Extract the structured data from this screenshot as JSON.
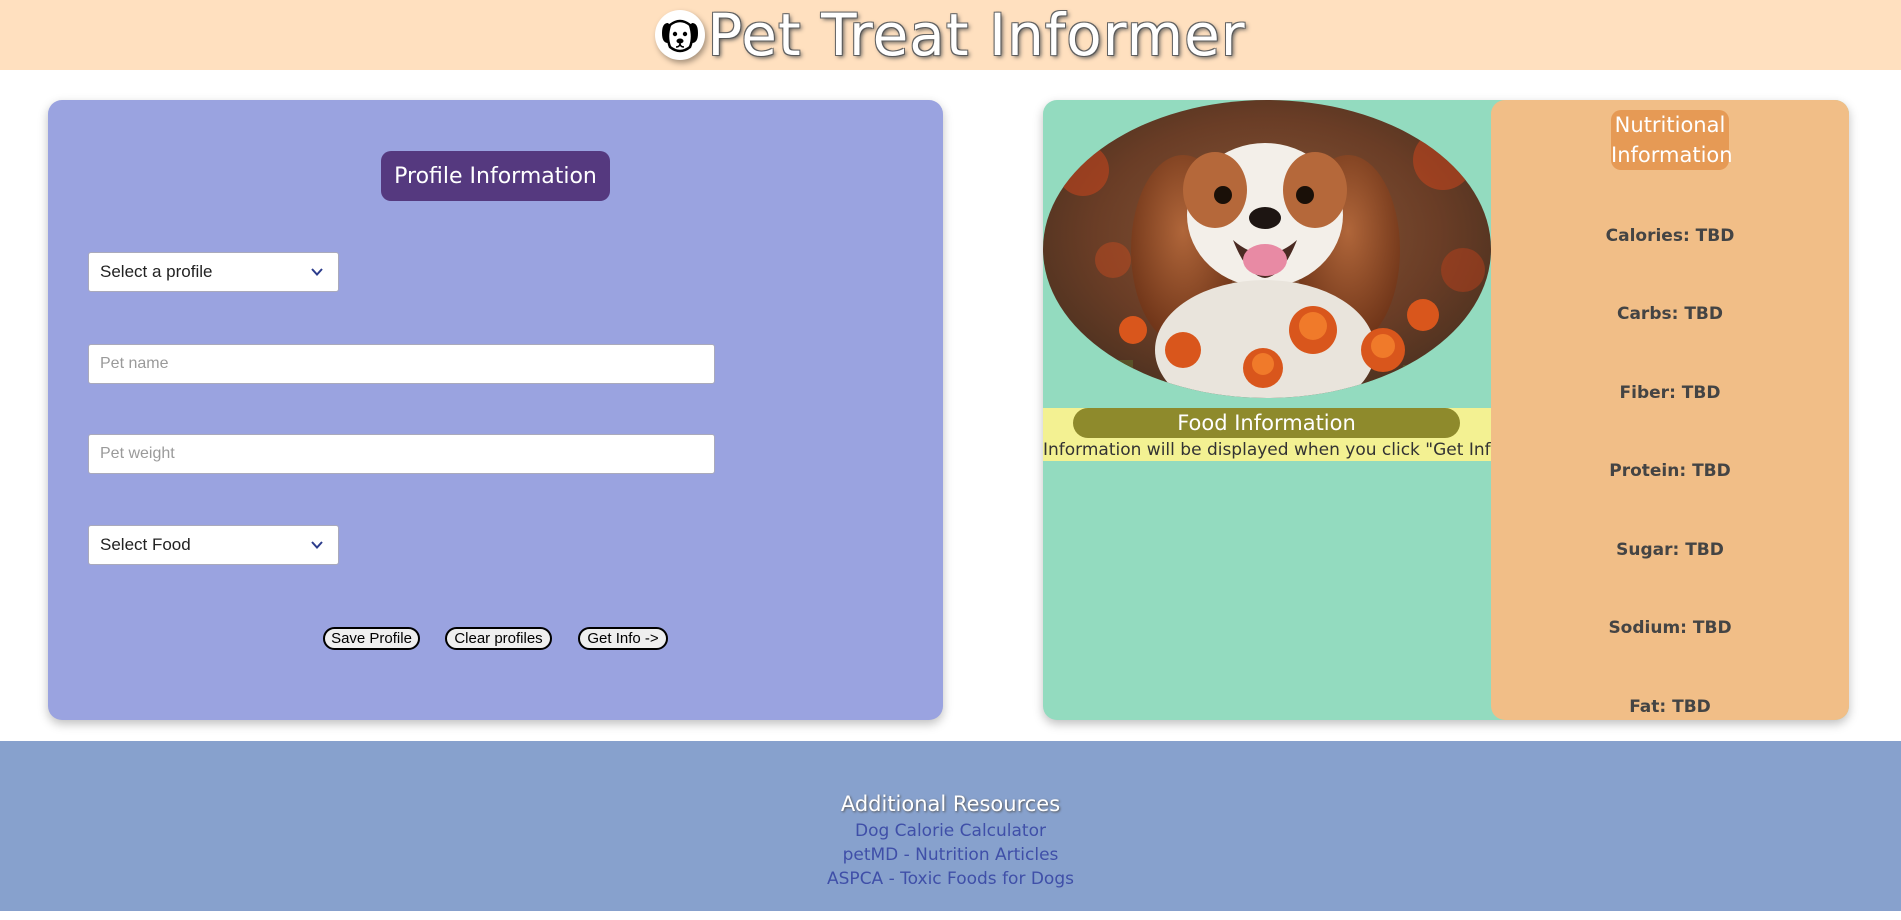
{
  "header": {
    "title": "Pet Treat Informer",
    "logo_icon": "dog-face-icon",
    "background": "#ffe0bf"
  },
  "profile": {
    "heading": "Profile Information",
    "profile_select": "Select a profile",
    "pet_name_placeholder": "Pet name",
    "pet_weight_placeholder": "Pet weight",
    "food_select": "Select Food",
    "buttons": {
      "save": "Save Profile",
      "clear": "Clear profiles",
      "get_info": "Get Info ->"
    },
    "panel_color": "#9aa3e0",
    "heading_color": "#55397f"
  },
  "food": {
    "heading": "Food Information",
    "info_text": "Information will be displayed when you click \"Get Info\""
  },
  "nutrition": {
    "heading": "Nutritional Information",
    "items": [
      {
        "label": "Calories: TBD"
      },
      {
        "label": "Carbs: TBD"
      },
      {
        "label": "Fiber: TBD"
      },
      {
        "label": "Protein: TBD"
      },
      {
        "label": "Sugar: TBD"
      },
      {
        "label": "Sodium: TBD"
      },
      {
        "label": "Fat: TBD"
      }
    ]
  },
  "footer": {
    "title": "Additional Resources",
    "links": [
      {
        "label": "Dog Calorie Calculator"
      },
      {
        "label": "petMD - Nutrition Articles"
      },
      {
        "label": "ASPCA - Toxic Foods for Dogs"
      }
    ]
  }
}
